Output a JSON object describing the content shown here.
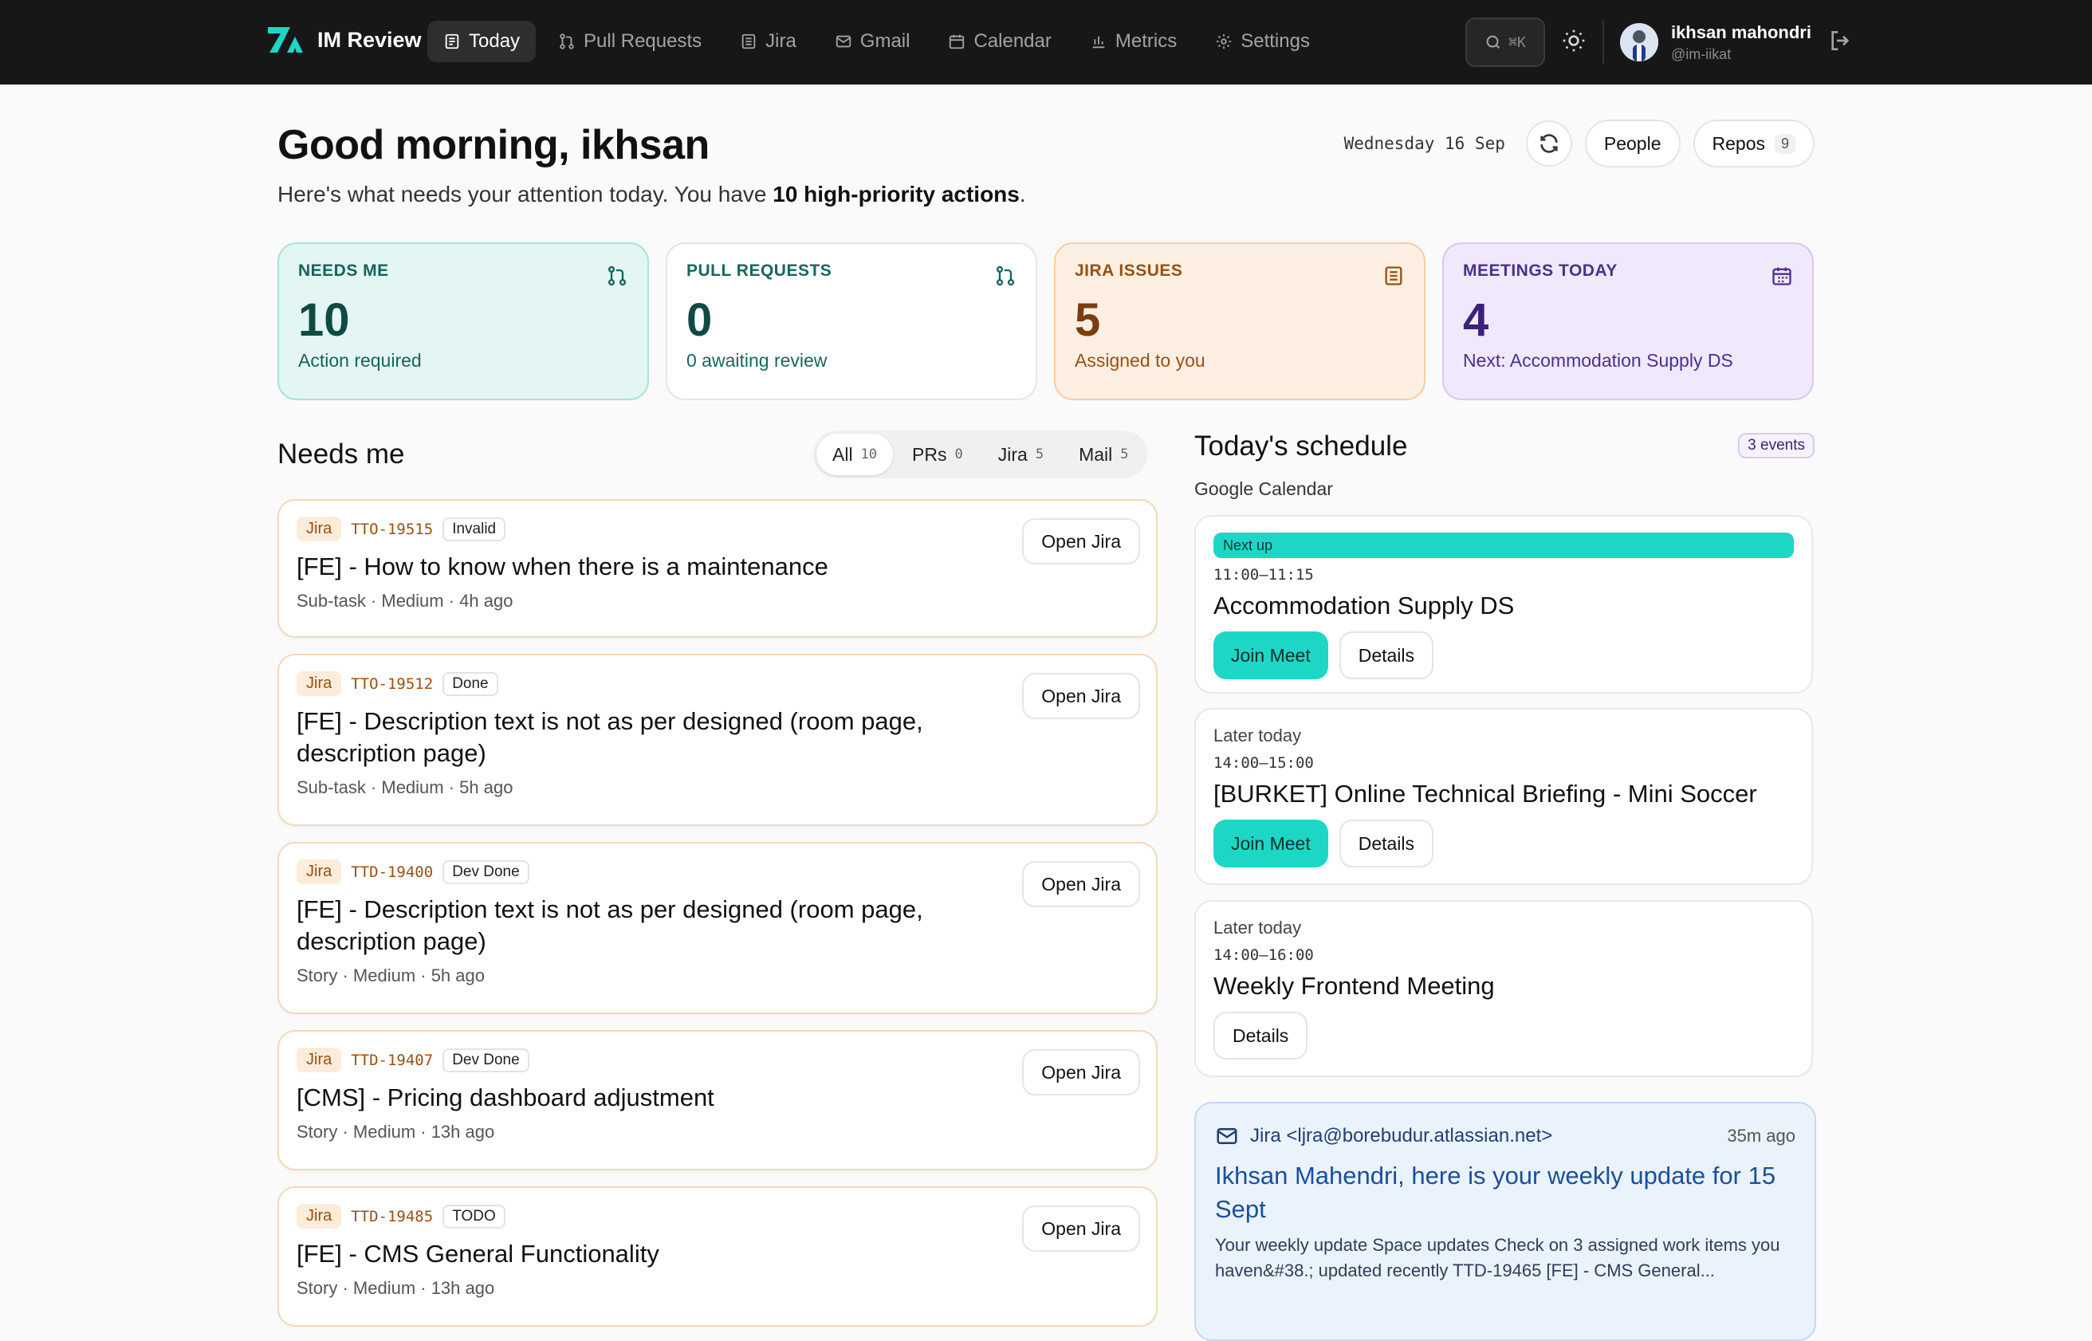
{
  "app": {
    "name": "IM Review"
  },
  "nav": [
    {
      "label": "Today",
      "active": true,
      "icon": "today-icon"
    },
    {
      "label": "Pull Requests",
      "active": false,
      "icon": "pull-request-icon"
    },
    {
      "label": "Jira",
      "active": false,
      "icon": "jira-icon"
    },
    {
      "label": "Gmail",
      "active": false,
      "icon": "mail-icon"
    },
    {
      "label": "Calendar",
      "active": false,
      "icon": "calendar-icon"
    },
    {
      "label": "Metrics",
      "active": false,
      "icon": "metrics-icon"
    },
    {
      "label": "Settings",
      "active": false,
      "icon": "gear-icon"
    }
  ],
  "search": {
    "shortcut": "⌘K"
  },
  "user": {
    "name": "ikhsan mahondri",
    "handle": "@im-iikat"
  },
  "header": {
    "greeting": "Good morning, ikhsan",
    "sub_prefix": "Here's what needs your attention today. You have ",
    "sub_bold": "10 high-priority actions",
    "sub_suffix": ".",
    "date": "Wednesday 16 Sep",
    "people_label": "People",
    "repos_label": "Repos",
    "repos_count": "9"
  },
  "stats": [
    {
      "label": "NEEDS ME",
      "value": "10",
      "desc": "Action required",
      "icon": "pull-request-icon"
    },
    {
      "label": "PULL REQUESTS",
      "value": "0",
      "desc": "0 awaiting review",
      "icon": "pull-request-icon"
    },
    {
      "label": "JIRA ISSUES",
      "value": "5",
      "desc": "Assigned to you",
      "icon": "jira-icon"
    },
    {
      "label": "MEETINGS TODAY",
      "value": "4",
      "desc": "Next: Accommodation Supply DS",
      "icon": "calendar-icon"
    }
  ],
  "needs": {
    "title": "Needs me",
    "filters": [
      {
        "label": "All",
        "count": "10",
        "active": true
      },
      {
        "label": "PRs",
        "count": "0",
        "active": false
      },
      {
        "label": "Jira",
        "count": "5",
        "active": false
      },
      {
        "label": "Mail",
        "count": "5",
        "active": false
      }
    ],
    "items": [
      {
        "source": "Jira",
        "key": "TTO-19515",
        "status": "Invalid",
        "title": "[FE] - How to know when there is a maintenance",
        "meta": "Sub-task · Medium · 4h ago",
        "action": "Open Jira"
      },
      {
        "source": "Jira",
        "key": "TTO-19512",
        "status": "Done",
        "title": "[FE] - Description text is not as per designed (room page, description page)",
        "meta": "Sub-task · Medium · 5h ago",
        "action": "Open Jira"
      },
      {
        "source": "Jira",
        "key": "TTD-19400",
        "status": "Dev Done",
        "title": "[FE] - Description text is not as per designed (room page, description page)",
        "meta": "Story · Medium · 5h ago",
        "action": "Open Jira"
      },
      {
        "source": "Jira",
        "key": "TTD-19407",
        "status": "Dev Done",
        "title": "[CMS] - Pricing dashboard adjustment",
        "meta": "Story · Medium · 13h ago",
        "action": "Open Jira"
      },
      {
        "source": "Jira",
        "key": "TTD-19485",
        "status": "TODO",
        "title": "[FE] - CMS General Functionality",
        "meta": "Story · Medium · 13h ago",
        "action": "Open Jira"
      }
    ]
  },
  "schedule": {
    "title": "Today's schedule",
    "count": "3 events",
    "source": "Google Calendar",
    "events": [
      {
        "badge": "Next up",
        "time": "11:00–11:15",
        "title": "Accommodation Supply DS",
        "join": "Join Meet",
        "details": "Details"
      },
      {
        "badge": "Later today",
        "time": "14:00–15:00",
        "title": "[BURKET] Online Technical Briefing - Mini Soccer",
        "join": "Join Meet",
        "details": "Details"
      },
      {
        "badge": "Later today",
        "time": "14:00–16:00",
        "title": "Weekly Frontend Meeting",
        "details": "Details"
      }
    ]
  },
  "mail": {
    "from": "Jira <ljra@borebudur.atlassian.net>",
    "ago": "35m ago",
    "subject": "Ikhsan Mahendri, here is your weekly update for 15 Sept",
    "body": "Your weekly update Space updates Check on 3 assigned work items you haven&#38.; updated recently TTD-19465 [FE] - CMS General..."
  },
  "colors": {
    "accent": "#1ed6c6",
    "topbar": "#171717",
    "jira": "#9a4f12"
  }
}
